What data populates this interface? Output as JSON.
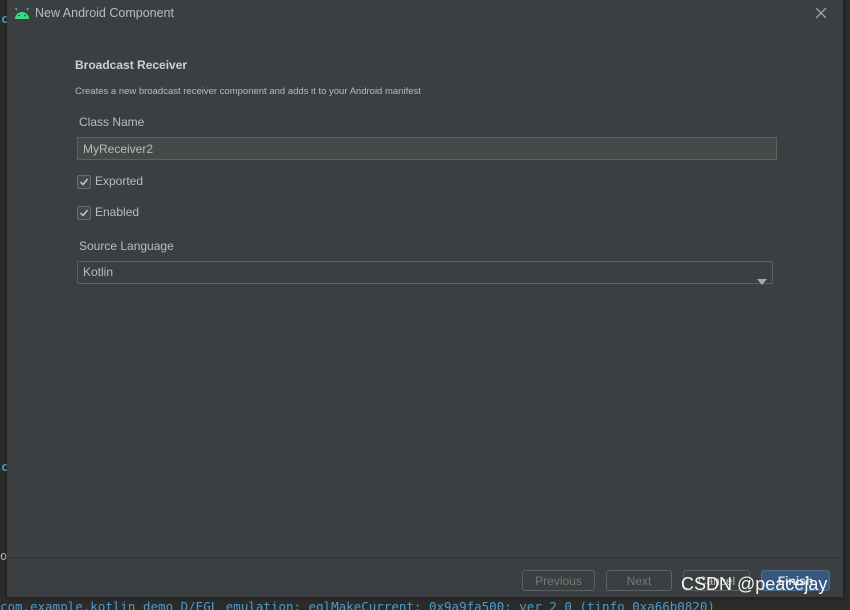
{
  "dialog": {
    "title": "New Android Component",
    "title_icon": "android-icon",
    "close_icon": "close-icon"
  },
  "form": {
    "heading": "Broadcast Receiver",
    "description": "Creates a new broadcast receiver component and adds it to your Android manifest",
    "class_name": {
      "label": "Class Name",
      "value": "MyReceiver2"
    },
    "exported": {
      "label": "Exported",
      "checked": true
    },
    "enabled": {
      "label": "Enabled",
      "checked": true
    },
    "source_language": {
      "label": "Source Language",
      "selected": "Kotlin"
    }
  },
  "buttons": {
    "previous": "Previous",
    "next": "Next",
    "cancel": "Cancel",
    "finish": "Finish"
  },
  "background": {
    "log_line": "com.example.kotlin_demo D/EGL_emulation: eglMakeCurrent: 0x9a9fa500: ver 2 0 (tinfo 0xa66b0820)"
  },
  "watermark": "CSDN @peacejay",
  "colors": {
    "dialog_bg": "#3c3f41",
    "accent_button": "#365880",
    "android_green": "#3ddc84"
  }
}
